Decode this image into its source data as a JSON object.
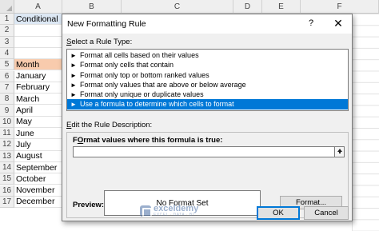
{
  "sheet": {
    "columns": [
      "A",
      "B",
      "C",
      "D",
      "E",
      "F"
    ],
    "rows": [
      {
        "num": "1",
        "value": "Conditional",
        "style": "title"
      },
      {
        "num": "2",
        "value": "",
        "style": ""
      },
      {
        "num": "3",
        "value": "",
        "style": ""
      },
      {
        "num": "4",
        "value": "",
        "style": ""
      },
      {
        "num": "5",
        "value": "Month",
        "style": "month"
      },
      {
        "num": "6",
        "value": "January",
        "style": ""
      },
      {
        "num": "7",
        "value": "February",
        "style": ""
      },
      {
        "num": "8",
        "value": "March",
        "style": ""
      },
      {
        "num": "9",
        "value": "April",
        "style": ""
      },
      {
        "num": "10",
        "value": "May",
        "style": ""
      },
      {
        "num": "11",
        "value": "June",
        "style": ""
      },
      {
        "num": "12",
        "value": "July",
        "style": ""
      },
      {
        "num": "13",
        "value": "August",
        "style": ""
      },
      {
        "num": "14",
        "value": "September",
        "style": ""
      },
      {
        "num": "15",
        "value": "October",
        "style": ""
      },
      {
        "num": "16",
        "value": "November",
        "style": ""
      },
      {
        "num": "17",
        "value": "December",
        "style": ""
      }
    ]
  },
  "dialog": {
    "title": "New Formatting Rule",
    "help": "?",
    "close": "✕",
    "select_rule_label_key": "S",
    "select_rule_label_rest": "elect a Rule Type:",
    "rule_types": [
      "Format all cells based on their values",
      "Format only cells that contain",
      "Format only top or bottom ranked values",
      "Format only values that are above or below average",
      "Format only unique or duplicate values",
      "Use a formula to determine which cells to format"
    ],
    "selected_rule_index": 5,
    "edit_label_key": "E",
    "edit_label_rest": "dit the Rule Description:",
    "formula_label_key": "O",
    "formula_label_pre": "F",
    "formula_label_rest": "rmat values where this formula is true:",
    "formula_value": "",
    "collapse_icon": "collapse-dialog-icon",
    "preview_label": "Preview:",
    "preview_text": "No Format Set",
    "format_button": "Format...",
    "ok_button": "OK",
    "cancel_button": "Cancel"
  },
  "watermark": {
    "name": "exceldemy",
    "tagline": "EXCEL · DATA · BI"
  },
  "colors": {
    "selection": "#0078d7",
    "title_cell_fill": "#dde8f4",
    "month_cell_fill": "#f8cbad"
  }
}
